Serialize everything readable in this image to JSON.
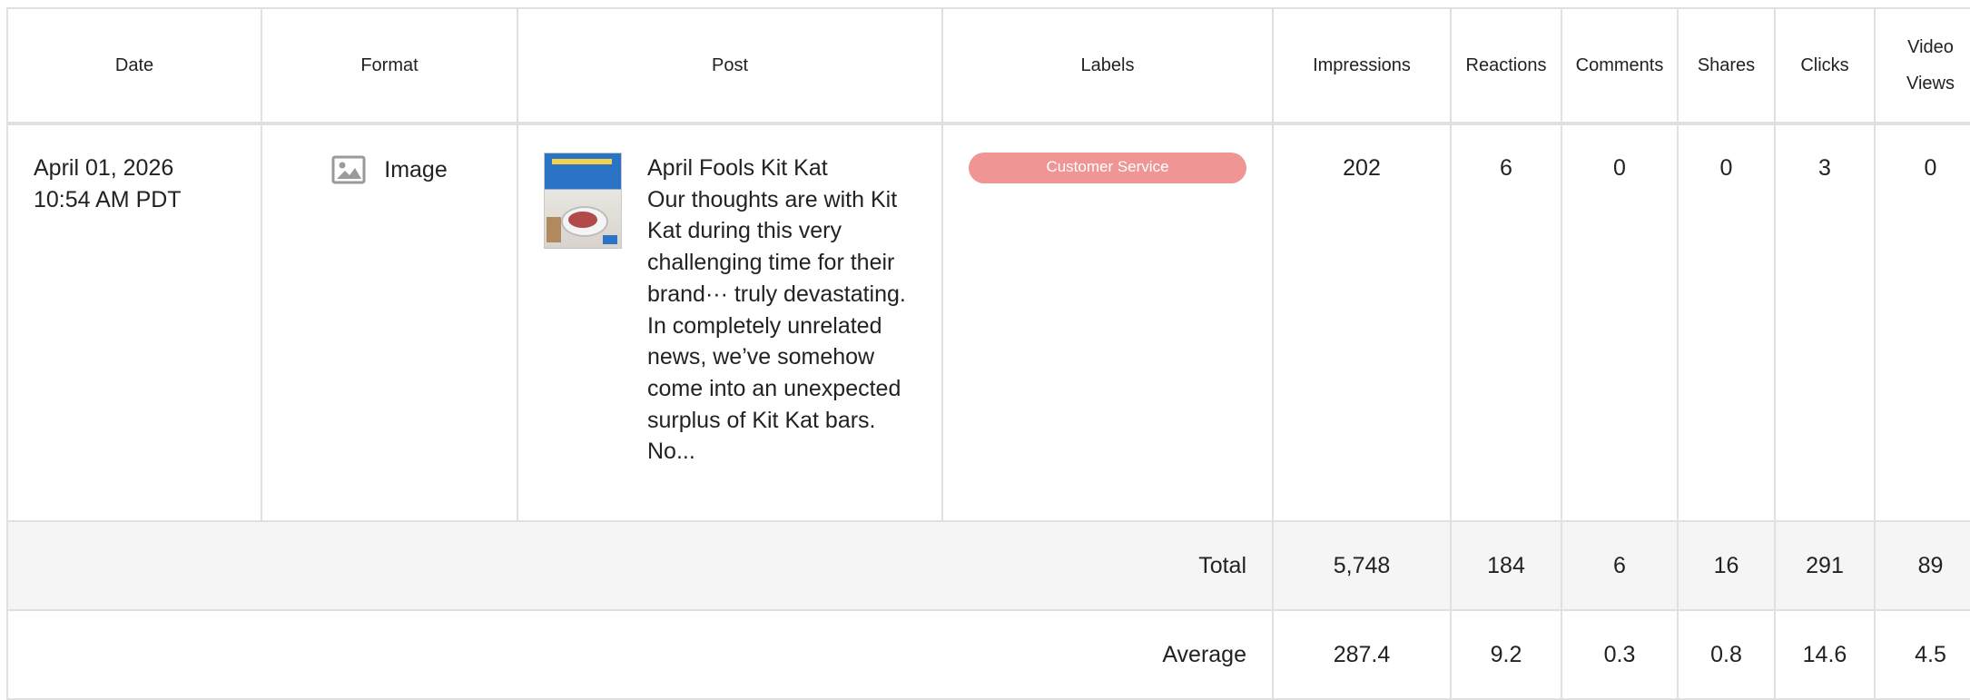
{
  "columns": {
    "date": "Date",
    "format": "Format",
    "post": "Post",
    "labels": "Labels",
    "impressions": "Impressions",
    "reactions": "Reactions",
    "comments": "Comments",
    "shares": "Shares",
    "clicks": "Clicks",
    "video_views_line1": "Video",
    "video_views_line2": "Views"
  },
  "row": {
    "date": "April 01, 2026",
    "time": "10:54 AM PDT",
    "format_icon": "image-icon",
    "format": "Image",
    "post_title": "April Fools Kit Kat",
    "post_body": "Our thoughts are with Kit Kat during this very challenging time for their brand··· truly devastating. In completely unrelated news, we’ve somehow come into an unexpected surplus of Kit Kat bars. No...",
    "label": "Customer Service",
    "label_color": "#ef9593",
    "impressions": "202",
    "reactions": "6",
    "comments": "0",
    "shares": "0",
    "clicks": "3",
    "video_views": "0"
  },
  "total": {
    "label": "Total",
    "impressions": "5,748",
    "reactions": "184",
    "comments": "6",
    "shares": "16",
    "clicks": "291",
    "video_views": "89"
  },
  "average": {
    "label": "Average",
    "impressions": "287.4",
    "reactions": "9.2",
    "comments": "0.3",
    "shares": "0.8",
    "clicks": "14.6",
    "video_views": "4.5"
  }
}
